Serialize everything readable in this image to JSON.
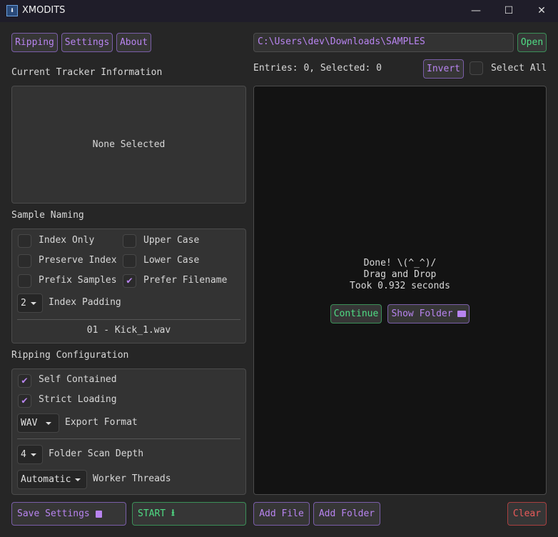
{
  "window": {
    "title": "XMODITS",
    "minimize": "—",
    "maximize": "☐",
    "close": "✕"
  },
  "nav": {
    "ripping": "Ripping",
    "settings": "Settings",
    "about": "About"
  },
  "tracker": {
    "heading": "Current Tracker Information",
    "status": "None Selected"
  },
  "naming": {
    "heading": "Sample Naming",
    "index_only": "Index Only",
    "upper_case": "Upper Case",
    "preserve_index": "Preserve Index",
    "lower_case": "Lower Case",
    "prefix_samples": "Prefix Samples",
    "prefer_filename": "Prefer Filename",
    "padding_value": "2",
    "padding_label": "Index Padding",
    "preview": "01 - Kick_1.wav",
    "checked": {
      "index_only": false,
      "upper_case": false,
      "preserve_index": false,
      "lower_case": false,
      "prefix_samples": false,
      "prefer_filename": true
    }
  },
  "ripping": {
    "heading": "Ripping Configuration",
    "self_contained": "Self Contained",
    "strict_loading": "Strict Loading",
    "format_value": "WAV",
    "format_label": "Export Format",
    "depth_value": "4",
    "depth_label": "Folder Scan Depth",
    "threads_value": "Automatic",
    "threads_label": "Worker Threads"
  },
  "path": {
    "value": "C:\\Users\\dev\\Downloads\\SAMPLES",
    "open": "Open"
  },
  "entries": {
    "summary": "Entries: 0, Selected: 0",
    "invert": "Invert",
    "select_all": "Select All"
  },
  "result": {
    "line1": "Done! \\(^_^)/",
    "line2": "Drag and Drop",
    "line3": "Took 0.932 seconds",
    "continue": "Continue",
    "show_folder": "Show Folder"
  },
  "footer": {
    "save": "Save Settings",
    "start": "START",
    "add_file": "Add File",
    "add_folder": "Add Folder",
    "clear": "Clear"
  },
  "colors": {
    "accent": "#b884f0",
    "green": "#4fdc84",
    "red": "#e85a5a"
  }
}
